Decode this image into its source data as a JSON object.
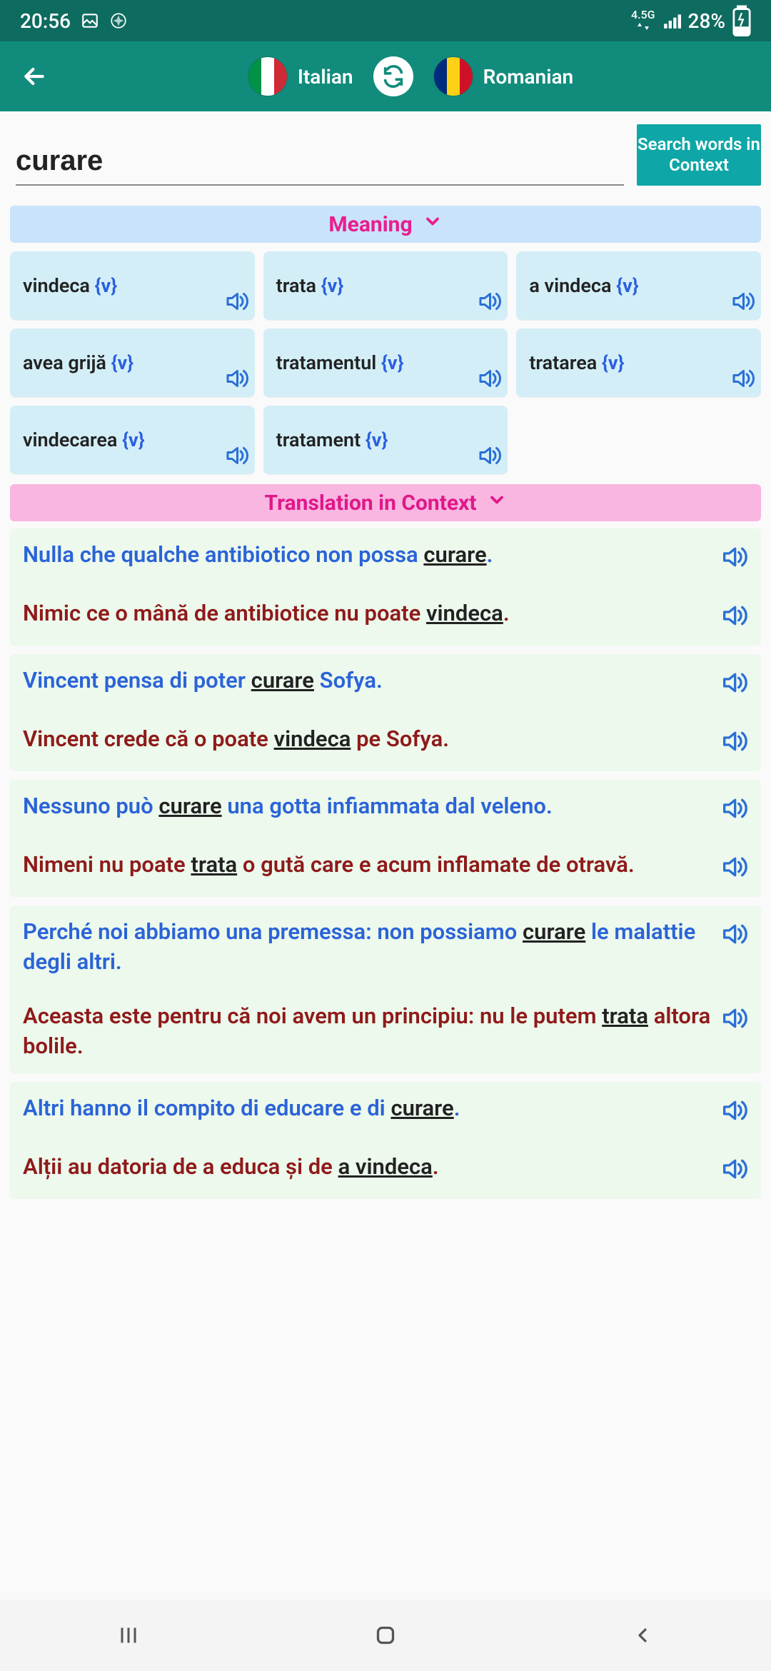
{
  "status": {
    "time": "20:56",
    "network_label": "4.5G",
    "battery": "28%"
  },
  "header": {
    "source_lang": "Italian",
    "target_lang": "Romanian"
  },
  "search": {
    "query": "curare",
    "button_line1": "Search words in",
    "button_line2": "Context"
  },
  "sections": {
    "meaning_title": "Meaning",
    "context_title": "Translation in Context"
  },
  "meanings": [
    {
      "word": "vindeca",
      "pos": "{v}"
    },
    {
      "word": "trata",
      "pos": "{v}"
    },
    {
      "word": "a vindeca",
      "pos": "{v}"
    },
    {
      "word": "avea grijă",
      "pos": "{v}"
    },
    {
      "word": "tratamentul",
      "pos": "{v}"
    },
    {
      "word": "tratarea",
      "pos": "{v}"
    },
    {
      "word": "vindecarea",
      "pos": "{v}"
    },
    {
      "word": "tratament",
      "pos": "{v}"
    }
  ],
  "context_examples": [
    {
      "src_pre": "Nulla che qualche antibiotico non possa ",
      "src_hl": "curare",
      "src_post": ".",
      "tgt_pre": "Nimic ce o mână de antibiotice nu poate ",
      "tgt_hl": "vindeca",
      "tgt_post": "."
    },
    {
      "src_pre": "Vincent pensa di poter ",
      "src_hl": "curare",
      "src_post": " Sofya.",
      "tgt_pre": "Vincent crede că o poate ",
      "tgt_hl": "vindeca",
      "tgt_post": " pe Sofya."
    },
    {
      "src_pre": "Nessuno può ",
      "src_hl": "curare",
      "src_post": " una gotta infiammata dal veleno.",
      "tgt_pre": "Nimeni nu poate ",
      "tgt_hl": "trata",
      "tgt_post": " o gută care e acum inflamate de otravă."
    },
    {
      "src_pre": "Perché noi abbiamo una premessa: non possiamo ",
      "src_hl": "curare",
      "src_post": " le malattie degli altri.",
      "tgt_pre": "Aceasta este pentru că noi avem un principiu: nu le putem ",
      "tgt_hl": "trata",
      "tgt_post": " altora bolile."
    },
    {
      "src_pre": "Altri hanno il compito di educare e di ",
      "src_hl": "curare",
      "src_post": ".",
      "tgt_pre": "Alții au datoria de a educa și de ",
      "tgt_hl": "a vindeca",
      "tgt_post": "."
    }
  ]
}
